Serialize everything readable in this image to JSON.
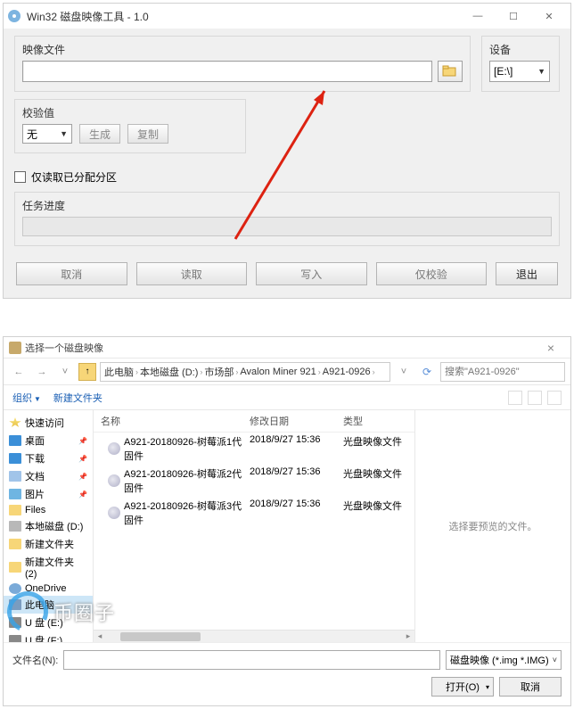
{
  "win1": {
    "title": "Win32 磁盘映像工具 - 1.0",
    "groups": {
      "imageFile": "映像文件",
      "device": "设备",
      "hash": "校验值",
      "progress": "任务进度"
    },
    "imagePath": "",
    "deviceValue": "[E:\\]",
    "hashValue": "无",
    "btn": {
      "generate": "生成",
      "copy": "复制"
    },
    "checkbox": "仅读取已分配分区",
    "actions": {
      "cancel": "取消",
      "read": "读取",
      "write": "写入",
      "verify": "仅校验",
      "exit": "退出"
    }
  },
  "win2": {
    "title": "选择一个磁盘映像",
    "breadcrumb": [
      "此电脑",
      "本地磁盘 (D:)",
      "市场部",
      "Avalon Miner 921",
      "A921-0926"
    ],
    "searchPlaceholder": "搜索\"A921-0926\"",
    "toolbar": {
      "organize": "组织",
      "newFolder": "新建文件夹"
    },
    "sidebar": [
      {
        "label": "快速访问",
        "icon": "star",
        "pinned": false
      },
      {
        "label": "桌面",
        "icon": "desk",
        "pinned": true
      },
      {
        "label": "下载",
        "icon": "dl",
        "pinned": true
      },
      {
        "label": "文档",
        "icon": "doc",
        "pinned": true
      },
      {
        "label": "图片",
        "icon": "pic",
        "pinned": true
      },
      {
        "label": "Files",
        "icon": "folder",
        "pinned": false
      },
      {
        "label": "本地磁盘 (D:)",
        "icon": "disk",
        "pinned": false
      },
      {
        "label": "新建文件夹",
        "icon": "folder",
        "pinned": false
      },
      {
        "label": "新建文件夹 (2)",
        "icon": "folder",
        "pinned": false
      },
      {
        "label": "OneDrive",
        "icon": "cloud",
        "pinned": false
      },
      {
        "label": "此电脑",
        "icon": "pc",
        "pinned": false,
        "selected": true
      },
      {
        "label": "U 盘 (E:)",
        "icon": "usb",
        "pinned": false
      },
      {
        "label": "U 盘 (F:)",
        "icon": "usb",
        "pinned": false
      }
    ],
    "columns": {
      "name": "名称",
      "date": "修改日期",
      "type": "类型"
    },
    "files": [
      {
        "name": "A921-20180926-树莓派1代固件",
        "date": "2018/9/27 15:36",
        "type": "光盘映像文件"
      },
      {
        "name": "A921-20180926-树莓派2代固件",
        "date": "2018/9/27 15:36",
        "type": "光盘映像文件"
      },
      {
        "name": "A921-20180926-树莓派3代固件",
        "date": "2018/9/27 15:36",
        "type": "光盘映像文件"
      }
    ],
    "previewMsg": "选择要预览的文件。",
    "footer": {
      "fnameLabel": "文件名(N):",
      "fnameValue": "",
      "filterValue": "磁盘映像 (*.img *.IMG)",
      "open": "打开(O)",
      "cancel": "取消"
    }
  },
  "watermark": "币圈子"
}
